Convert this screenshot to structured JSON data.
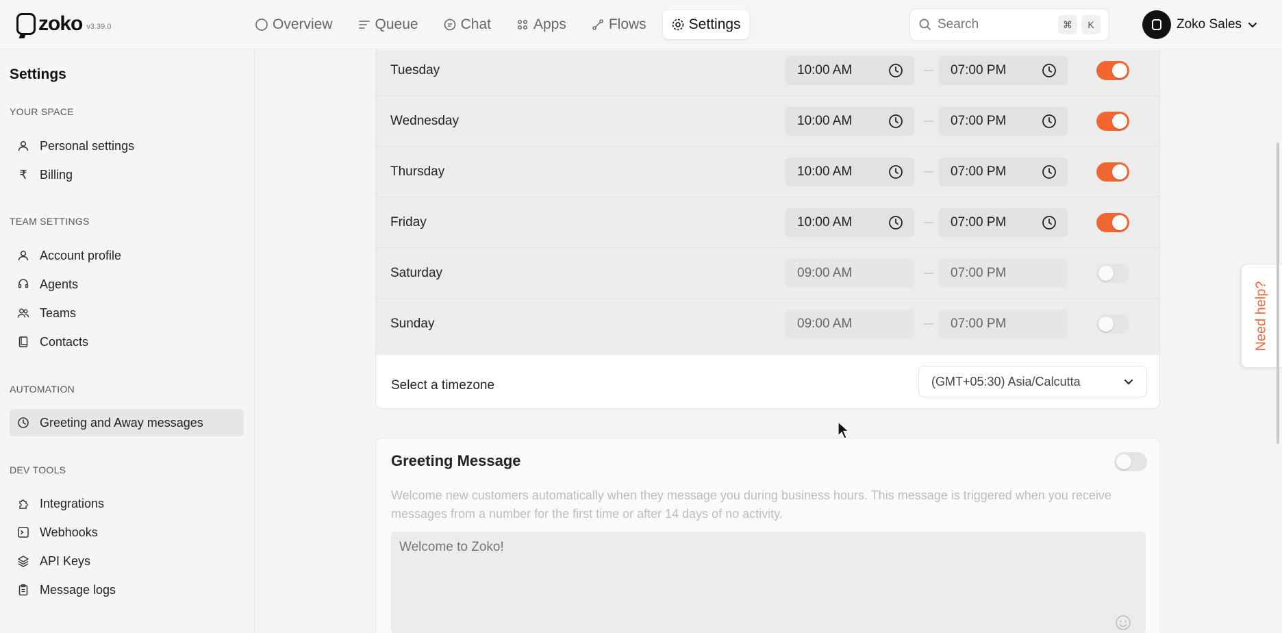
{
  "brand": {
    "name": "zoko",
    "version": "v3.39.0"
  },
  "nav": {
    "items": [
      {
        "label": "Overview",
        "icon": "circle-icon"
      },
      {
        "label": "Queue",
        "icon": "queue-icon"
      },
      {
        "label": "Chat",
        "icon": "chat-icon"
      },
      {
        "label": "Apps",
        "icon": "apps-icon"
      },
      {
        "label": "Flows",
        "icon": "flows-icon"
      },
      {
        "label": "Settings",
        "icon": "gear-icon",
        "active": true
      }
    ]
  },
  "search": {
    "placeholder": "Search",
    "shortcut_key1": "⌘",
    "shortcut_key2": "K"
  },
  "account": {
    "name": "Zoko Sales"
  },
  "sidebar": {
    "title": "Settings",
    "sections": [
      {
        "label": "YOUR SPACE",
        "items": [
          {
            "label": "Personal settings"
          },
          {
            "label": "Billing"
          }
        ]
      },
      {
        "label": "TEAM SETTINGS",
        "items": [
          {
            "label": "Account profile"
          },
          {
            "label": "Agents"
          },
          {
            "label": "Teams"
          },
          {
            "label": "Contacts"
          }
        ]
      },
      {
        "label": "AUTOMATION",
        "items": [
          {
            "label": "Greeting and Away messages",
            "active": true
          }
        ]
      },
      {
        "label": "DEV TOOLS",
        "items": [
          {
            "label": "Integrations"
          },
          {
            "label": "Webhooks"
          },
          {
            "label": "API Keys"
          },
          {
            "label": "Message logs"
          }
        ]
      }
    ]
  },
  "business_hours": {
    "days": [
      {
        "name": "Tuesday",
        "start": "10:00 AM",
        "end": "07:00 PM",
        "enabled": true
      },
      {
        "name": "Wednesday",
        "start": "10:00 AM",
        "end": "07:00 PM",
        "enabled": true
      },
      {
        "name": "Thursday",
        "start": "10:00 AM",
        "end": "07:00 PM",
        "enabled": true
      },
      {
        "name": "Friday",
        "start": "10:00 AM",
        "end": "07:00 PM",
        "enabled": true
      },
      {
        "name": "Saturday",
        "start": "09:00 AM",
        "end": "07:00 PM",
        "enabled": false
      },
      {
        "name": "Sunday",
        "start": "09:00 AM",
        "end": "07:00 PM",
        "enabled": false
      }
    ],
    "timezone_label": "Select a timezone",
    "timezone_value": "(GMT+05:30) Asia/Calcutta"
  },
  "greeting": {
    "title": "Greeting Message",
    "enabled": false,
    "description": "Welcome new customers automatically when they message you during business hours. This message is triggered when you receive messages from a number for the first time or after 14 days of no activity.",
    "placeholder": "Welcome to Zoko!"
  },
  "help": {
    "label": "Need help?"
  },
  "colors": {
    "accent": "#f26631",
    "toggle_off": "#e4e4e4",
    "active_bg": "#e6e6e6"
  }
}
